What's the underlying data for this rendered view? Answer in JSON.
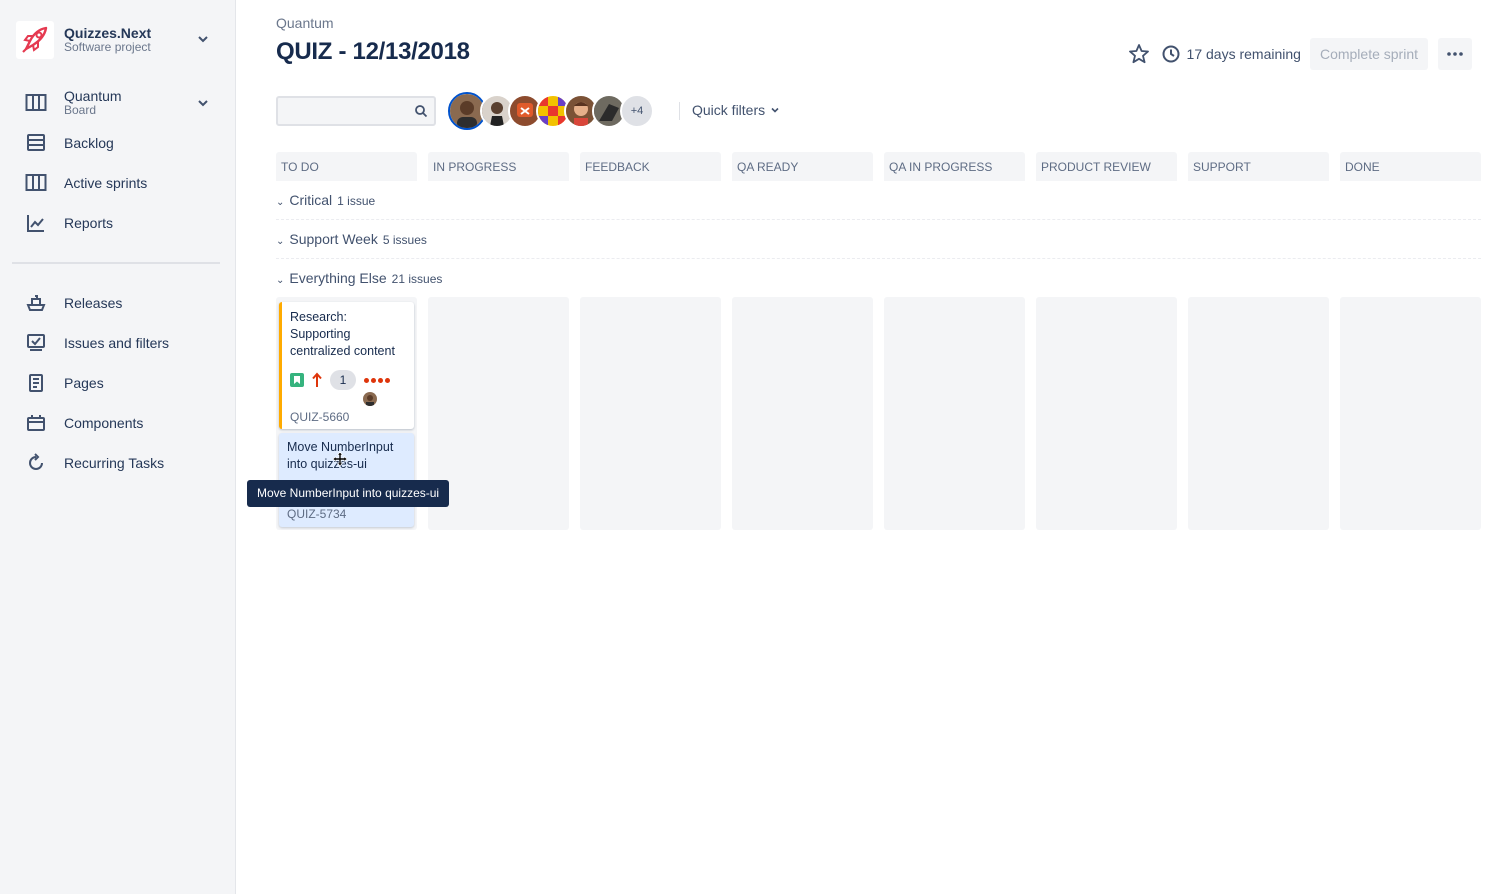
{
  "project": {
    "name": "Quizzes.Next",
    "type": "Software project"
  },
  "sidebar": {
    "board": {
      "title": "Quantum",
      "sub": "Board"
    },
    "items": [
      {
        "label": "Backlog",
        "icon": "backlog-icon"
      },
      {
        "label": "Active sprints",
        "icon": "board-icon"
      },
      {
        "label": "Reports",
        "icon": "chart-icon"
      }
    ],
    "items2": [
      {
        "label": "Releases",
        "icon": "ship-icon"
      },
      {
        "label": "Issues and filters",
        "icon": "issues-icon"
      },
      {
        "label": "Pages",
        "icon": "page-icon"
      },
      {
        "label": "Components",
        "icon": "component-icon"
      },
      {
        "label": "Recurring Tasks",
        "icon": "refresh-icon"
      }
    ]
  },
  "header": {
    "breadcrumb": "Quantum",
    "title": "QUIZ - 12/13/2018",
    "remaining": "17 days remaining",
    "complete_label": "Complete sprint"
  },
  "filters": {
    "search_placeholder": "",
    "more_avatars": "+4",
    "quick_filters": "Quick filters"
  },
  "columns": [
    "TO DO",
    "IN PROGRESS",
    "FEEDBACK",
    "QA READY",
    "QA IN PROGRESS",
    "PRODUCT REVIEW",
    "SUPPORT",
    "DONE"
  ],
  "swimlanes": [
    {
      "name": "Critical",
      "count": "1 issue"
    },
    {
      "name": "Support Week",
      "count": "5 issues"
    },
    {
      "name": "Everything Else",
      "count": "21 issues"
    }
  ],
  "cards": [
    {
      "summary": "Research: Supporting centralized content",
      "points": "1",
      "key": "QUIZ-5660"
    },
    {
      "summary": "Move NumberInput into quizzes-ui",
      "key": "QUIZ-5734"
    }
  ],
  "tooltip": "Move NumberInput into quizzes-ui",
  "colors": {
    "accent": "#0052cc",
    "story": "#36b37e",
    "priority": "#de350b",
    "flag": "#ffab00"
  }
}
